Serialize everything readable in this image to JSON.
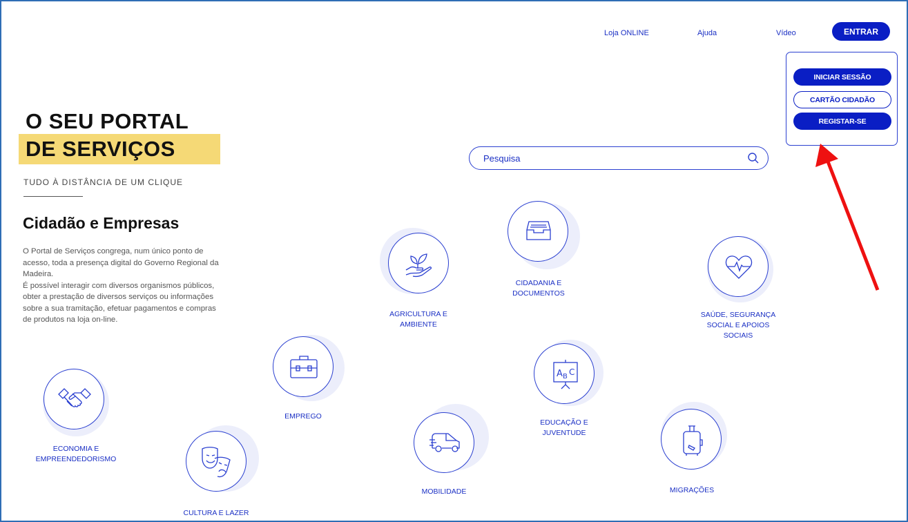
{
  "nav": {
    "loja": "Loja ONLINE",
    "ajuda": "Ajuda",
    "video": "Vídeo",
    "entrar": "ENTRAR"
  },
  "login_menu": {
    "iniciar": "INICIAR SESSÃO",
    "cartao": "CARTÃO CIDADÃO",
    "registar": "REGISTAR-SE"
  },
  "hero": {
    "line1": "O SEU PORTAL",
    "line2": "DE SERVIÇOS",
    "tagline": "TUDO À DISTÂNCIA DE UM CLIQUE"
  },
  "section": {
    "title": "Cidadão e Empresas",
    "para1": "O Portal de Serviços congrega, num único ponto de acesso, toda a presença digital do Governo Regional da Madeira.",
    "para2": "É possível interagir com diversos organismos públicos, obter a prestação de diversos serviços ou informações sobre a sua tramitação, efetuar pagamentos e compras de produtos na loja on-line."
  },
  "search": {
    "placeholder": "Pesquisa"
  },
  "services": {
    "agricultura": {
      "l1": "AGRICULTURA E",
      "l2": "AMBIENTE",
      "icon": "plant-hand-icon"
    },
    "cidadania": {
      "l1": "CIDADANIA E",
      "l2": "DOCUMENTOS",
      "icon": "archive-box-icon"
    },
    "saude": {
      "l1": "SAÚDE, SEGURANÇA",
      "l2": "SOCIAL E APOIOS",
      "l3": "SOCIAIS",
      "icon": "heart-pulse-icon"
    },
    "economia": {
      "l1": "ECONOMIA E",
      "l2": "EMPREENDEDORISMO",
      "icon": "handshake-icon"
    },
    "emprego": {
      "l1": "EMPREGO",
      "icon": "briefcase-icon"
    },
    "educacao": {
      "l1": "EDUCAÇÃO E",
      "l2": "JUVENTUDE",
      "icon": "abc-board-icon"
    },
    "cultura": {
      "l1": "CULTURA E LAZER",
      "icon": "theater-masks-icon"
    },
    "mobilidade": {
      "l1": "MOBILIDADE",
      "icon": "van-icon"
    },
    "migracoes": {
      "l1": "MIGRAÇÕES",
      "icon": "luggage-icon"
    }
  },
  "colors": {
    "primary": "#0a1ec4",
    "highlight": "#f5d976",
    "annotation_arrow": "#ee1111",
    "frame": "#2f6db5"
  }
}
